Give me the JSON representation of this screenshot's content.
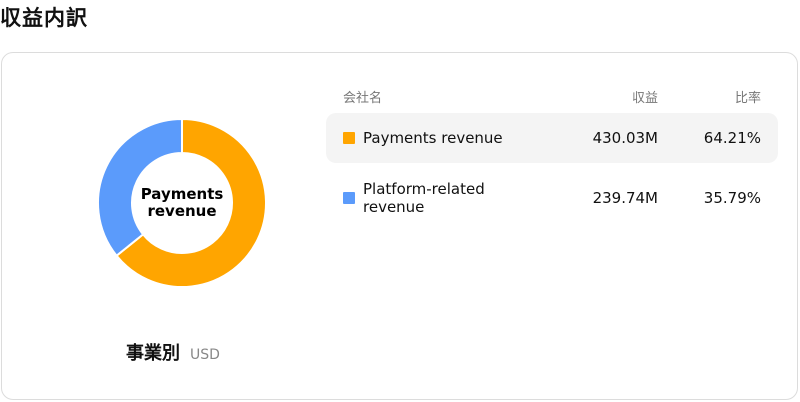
{
  "page": {
    "title": "収益内訳"
  },
  "table": {
    "headers": {
      "name": "会社名",
      "revenue": "収益",
      "ratio": "比率"
    },
    "rows": [
      {
        "name": "Payments revenue",
        "revenue": "430.03M",
        "ratio": "64.21%",
        "color": "#ffa500"
      },
      {
        "name": "Platform-related revenue",
        "revenue": "239.74M",
        "ratio": "35.79%",
        "color": "#5b9bfb"
      }
    ]
  },
  "chart": {
    "center_label": "Payments revenue",
    "caption": "事業別",
    "unit": "USD"
  },
  "chart_data": {
    "type": "pie",
    "categories": [
      "Payments revenue",
      "Platform-related revenue"
    ],
    "values": [
      430.03,
      239.74
    ],
    "percentages": [
      64.21,
      35.79
    ],
    "colors": [
      "#ffa500",
      "#5b9bfb"
    ],
    "unit": "USD"
  }
}
